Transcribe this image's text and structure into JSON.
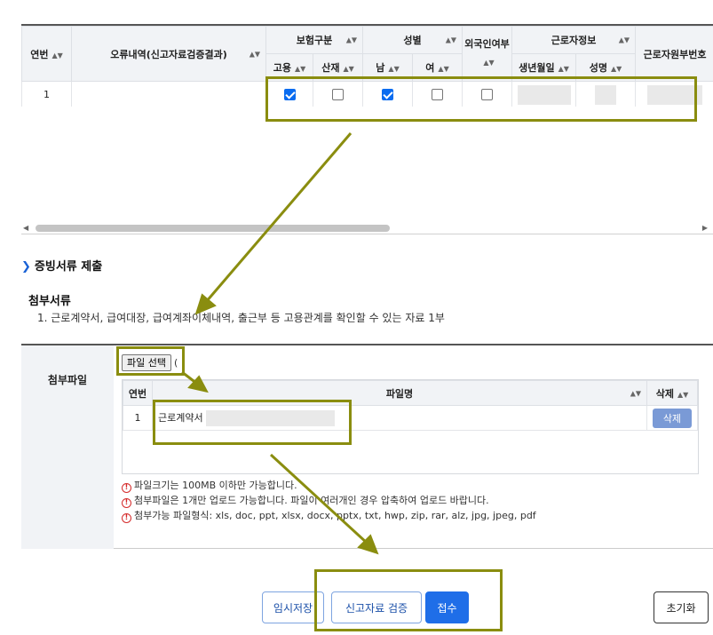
{
  "grid": {
    "headers": {
      "seq": "연번",
      "error": "오류내역(신고자료검증결과)",
      "insurance": "보험구분",
      "ins_employment": "고용",
      "ins_industrial": "산재",
      "gender": "성별",
      "gender_male": "남",
      "gender_female": "여",
      "foreigner": "외국인여부",
      "worker_info": "근로자정보",
      "birth": "생년월일",
      "name": "성명",
      "worker_no": "근로자원부번호"
    },
    "rows": [
      {
        "seq": "1",
        "employment": true,
        "industrial": false,
        "male": true,
        "female": false,
        "foreigner": false
      }
    ]
  },
  "section": {
    "title": "증빙서류 제출",
    "attach_title": "첨부서류",
    "attach_desc": "1. 근로계약서, 급여대장, 급여계좌이체내역, 출근부 등 고용관계를 확인할 수 있는 자료 1부"
  },
  "attach": {
    "label": "첨부파일",
    "file_button": "파일 선택",
    "chosen_text": "(",
    "table_headers": {
      "seq": "연번",
      "filename": "파일명",
      "delete": "삭제"
    },
    "files": [
      {
        "seq": "1",
        "name": "근로계약서",
        "delete": "삭제"
      }
    ],
    "notes": [
      "파일크기는 100MB 이하만 가능합니다.",
      "첨부파일은 1개만 업로드 가능합니다. 파일이 여러개인 경우 압축하여 업로드 바랍니다.",
      "첨부가능 파일형식: xls, doc, ppt, xlsx, docx, pptx, txt, hwp, zip, rar, alz, jpg, jpeg, pdf"
    ]
  },
  "buttons": {
    "temp_save": "임시저장",
    "validate": "신고자료 검증",
    "submit": "접수",
    "reset": "초기화"
  },
  "colors": {
    "accent": "#1f6ee8",
    "annotation": "#8a8d0f",
    "warn": "#d42a2a"
  }
}
